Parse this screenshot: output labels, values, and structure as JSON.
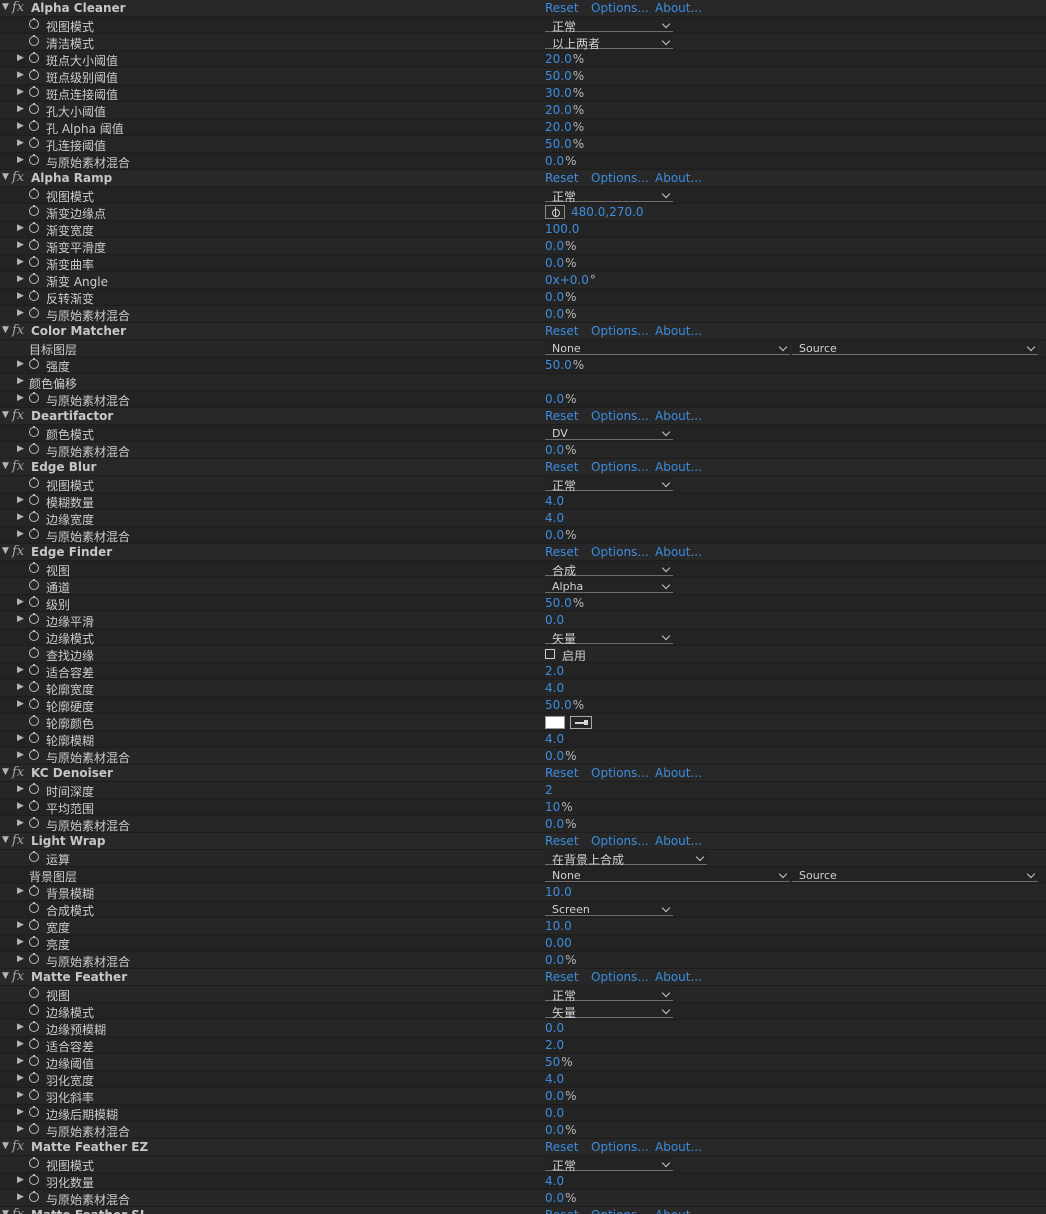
{
  "links": {
    "reset": "Reset",
    "options": "Options...",
    "about": "About..."
  },
  "colors": {
    "accent": "#3c8de0",
    "background": "#232323"
  },
  "groups": [
    {
      "name": "Alpha Cleaner",
      "props": [
        {
          "t": "dd",
          "label": "视图模式",
          "v": "正常"
        },
        {
          "t": "dd",
          "label": "清洁模式",
          "v": "以上两者"
        },
        {
          "t": "num",
          "label": "斑点大小阈值",
          "v": "20.0",
          "u": "%",
          "exp": true
        },
        {
          "t": "num",
          "label": "斑点级别阈值",
          "v": "50.0",
          "u": "%",
          "exp": true
        },
        {
          "t": "num",
          "label": "斑点连接阈值",
          "v": "30.0",
          "u": "%",
          "exp": true
        },
        {
          "t": "num",
          "label": "孔大小阈值",
          "v": "20.0",
          "u": "%",
          "exp": true
        },
        {
          "t": "num",
          "label": "孔 Alpha 阈值",
          "v": "20.0",
          "u": "%",
          "exp": true
        },
        {
          "t": "num",
          "label": "孔连接阈值",
          "v": "50.0",
          "u": "%",
          "exp": true
        },
        {
          "t": "num",
          "label": "与原始素材混合",
          "v": "0.0",
          "u": "%",
          "exp": true
        }
      ]
    },
    {
      "name": "Alpha Ramp",
      "props": [
        {
          "t": "dd",
          "label": "视图模式",
          "v": "正常"
        },
        {
          "t": "point",
          "label": "渐变边缘点",
          "v": "480.0,270.0"
        },
        {
          "t": "num",
          "label": "渐变宽度",
          "v": "100.0",
          "u": "",
          "exp": true
        },
        {
          "t": "num",
          "label": "渐变平滑度",
          "v": "0.0",
          "u": "%",
          "exp": true
        },
        {
          "t": "num",
          "label": "渐变曲率",
          "v": "0.0",
          "u": "%",
          "exp": true
        },
        {
          "t": "num",
          "label": "渐变 Angle",
          "v": "0x+0.0",
          "u": "°",
          "exp": true
        },
        {
          "t": "num",
          "label": "反转渐变",
          "v": "0.0",
          "u": "%",
          "exp": true
        },
        {
          "t": "num",
          "label": "与原始素材混合",
          "v": "0.0",
          "u": "%",
          "exp": true
        }
      ]
    },
    {
      "name": "Color Matcher",
      "props": [
        {
          "t": "layer",
          "label": "目标图层",
          "v": "None",
          "v2": "Source",
          "nosw": true
        },
        {
          "t": "num",
          "label": "强度",
          "v": "50.0",
          "u": "%",
          "exp": true
        },
        {
          "t": "blank",
          "label": "颜色偏移",
          "exp": true,
          "nosw": true
        },
        {
          "t": "num",
          "label": "与原始素材混合",
          "v": "0.0",
          "u": "%",
          "exp": true
        }
      ]
    },
    {
      "name": "Deartifactor",
      "props": [
        {
          "t": "dd",
          "label": "颜色模式",
          "v": "DV",
          "small": true
        },
        {
          "t": "num",
          "label": "与原始素材混合",
          "v": "0.0",
          "u": "%",
          "exp": true
        }
      ]
    },
    {
      "name": "Edge Blur",
      "props": [
        {
          "t": "dd",
          "label": "视图模式",
          "v": "正常"
        },
        {
          "t": "num",
          "label": "模糊数量",
          "v": "4.0",
          "u": "",
          "exp": true
        },
        {
          "t": "num",
          "label": "边缘宽度",
          "v": "4.0",
          "u": "",
          "exp": true
        },
        {
          "t": "num",
          "label": "与原始素材混合",
          "v": "0.0",
          "u": "%",
          "exp": true
        }
      ]
    },
    {
      "name": "Edge Finder",
      "props": [
        {
          "t": "dd",
          "label": "视图",
          "v": "合成"
        },
        {
          "t": "dd",
          "label": "通道",
          "v": "Alpha",
          "small": true
        },
        {
          "t": "num",
          "label": "级别",
          "v": "50.0",
          "u": "%",
          "exp": true
        },
        {
          "t": "num",
          "label": "边缘平滑",
          "v": "0.0",
          "u": "",
          "exp": true
        },
        {
          "t": "dd",
          "label": "边缘模式",
          "v": "矢量"
        },
        {
          "t": "check",
          "label": "查找边缘",
          "v": "启用"
        },
        {
          "t": "num",
          "label": "适合容差",
          "v": "2.0",
          "u": "",
          "exp": true
        },
        {
          "t": "num",
          "label": "轮廓宽度",
          "v": "4.0",
          "u": "",
          "exp": true
        },
        {
          "t": "num",
          "label": "轮廓硬度",
          "v": "50.0",
          "u": "%",
          "exp": true
        },
        {
          "t": "color",
          "label": "轮廓颜色",
          "v": "#ffffff"
        },
        {
          "t": "num",
          "label": "轮廓模糊",
          "v": "4.0",
          "u": "",
          "exp": true
        },
        {
          "t": "num",
          "label": "与原始素材混合",
          "v": "0.0",
          "u": "%",
          "exp": true
        }
      ]
    },
    {
      "name": "KC Denoiser",
      "props": [
        {
          "t": "num",
          "label": "时间深度",
          "v": "2",
          "u": "",
          "exp": true
        },
        {
          "t": "num",
          "label": "平均范围",
          "v": "10",
          "u": "%",
          "exp": true
        },
        {
          "t": "num",
          "label": "与原始素材混合",
          "v": "0.0",
          "u": "%",
          "exp": true
        }
      ]
    },
    {
      "name": "Light Wrap",
      "props": [
        {
          "t": "ddwide",
          "label": "运算",
          "v": "在背景上合成"
        },
        {
          "t": "layer",
          "label": "背景图层",
          "v": "None",
          "v2": "Source",
          "nosw": true
        },
        {
          "t": "num",
          "label": "背景模糊",
          "v": "10.0",
          "u": "",
          "exp": true
        },
        {
          "t": "dd",
          "label": "合成模式",
          "v": "Screen",
          "small": true
        },
        {
          "t": "num",
          "label": "宽度",
          "v": "10.0",
          "u": "",
          "exp": true
        },
        {
          "t": "num",
          "label": "亮度",
          "v": "0.00",
          "u": "",
          "exp": true
        },
        {
          "t": "num",
          "label": "与原始素材混合",
          "v": "0.0",
          "u": "%",
          "exp": true
        }
      ]
    },
    {
      "name": "Matte Feather",
      "props": [
        {
          "t": "dd",
          "label": "视图",
          "v": "正常"
        },
        {
          "t": "dd",
          "label": "边缘模式",
          "v": "矢量"
        },
        {
          "t": "num",
          "label": "边缘预模糊",
          "v": "0.0",
          "u": "",
          "exp": true
        },
        {
          "t": "num",
          "label": "适合容差",
          "v": "2.0",
          "u": "",
          "exp": true
        },
        {
          "t": "num",
          "label": "边缘阈值",
          "v": "50",
          "u": "%",
          "exp": true
        },
        {
          "t": "num",
          "label": "羽化宽度",
          "v": "4.0",
          "u": "",
          "exp": true
        },
        {
          "t": "num",
          "label": "羽化斜率",
          "v": "0.0",
          "u": "%",
          "exp": true
        },
        {
          "t": "num",
          "label": "边缘后期模糊",
          "v": "0.0",
          "u": "",
          "exp": true
        },
        {
          "t": "num",
          "label": "与原始素材混合",
          "v": "0.0",
          "u": "%",
          "exp": true
        }
      ]
    },
    {
      "name": "Matte Feather EZ",
      "props": [
        {
          "t": "dd",
          "label": "视图模式",
          "v": "正常"
        },
        {
          "t": "num",
          "label": "羽化数量",
          "v": "4.0",
          "u": "",
          "exp": true
        },
        {
          "t": "num",
          "label": "与原始素材混合",
          "v": "0.0",
          "u": "%",
          "exp": true
        }
      ]
    },
    {
      "name": "Matte Feather SL",
      "props": []
    }
  ]
}
